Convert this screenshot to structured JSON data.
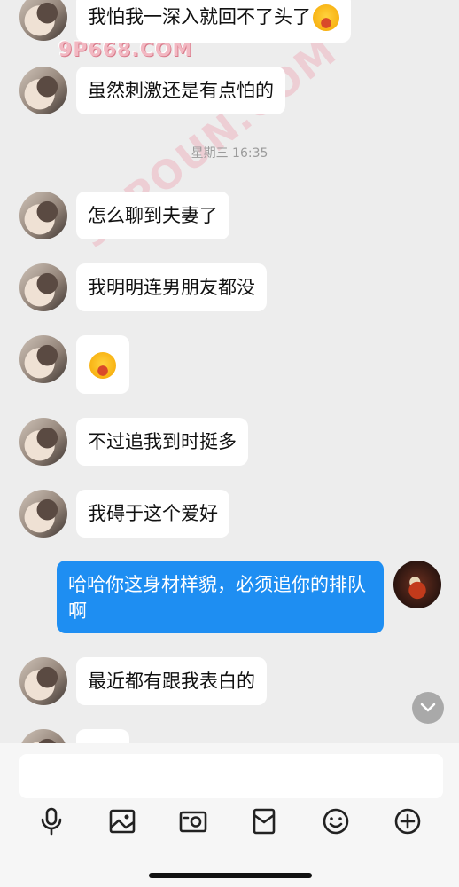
{
  "watermarks": {
    "small": "9P668.COM",
    "large": "91POUN.COM"
  },
  "timestamp": "星期三 16:35",
  "messages": [
    {
      "side": "left",
      "text": "我怕我一深入就回不了头了",
      "emoji": "joy"
    },
    {
      "side": "left",
      "text": "虽然刺激还是有点怕的"
    },
    {
      "side": "left",
      "text": "怎么聊到夫妻了"
    },
    {
      "side": "left",
      "text": "我明明连男朋友都没"
    },
    {
      "side": "left",
      "text": "",
      "emoji": "joy"
    },
    {
      "side": "left",
      "text": "不过追我到时挺多"
    },
    {
      "side": "left",
      "text": "我碍于这个爱好"
    },
    {
      "side": "right",
      "text": "哈哈你这身材样貌，必须追你的排队啊"
    },
    {
      "side": "left",
      "text": "最近都有跟我表白的"
    }
  ],
  "input": {
    "placeholder": ""
  },
  "toolbar": [
    "microphone-icon",
    "photo-icon",
    "camera-icon",
    "red-packet-icon",
    "emoji-icon",
    "plus-icon"
  ],
  "colors": {
    "accent": "#1e8ef2",
    "background": "#ededed"
  }
}
